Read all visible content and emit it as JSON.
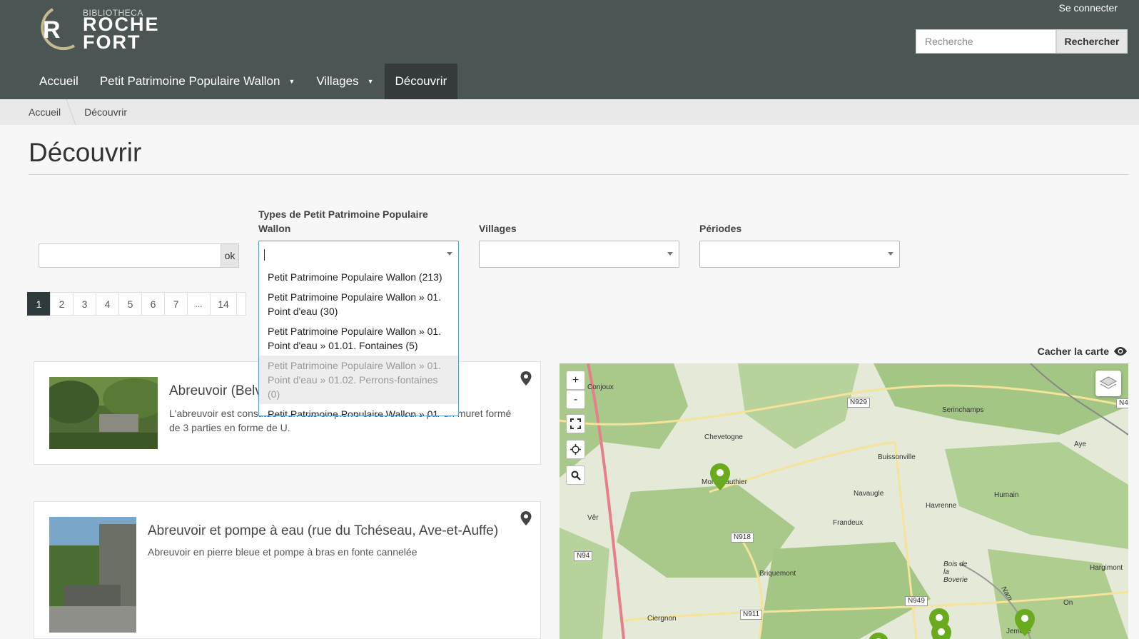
{
  "header": {
    "logo_small": "BIBLIOTHECA",
    "logo_line1": "ROCHE",
    "logo_line2": "FORT",
    "login": "Se connecter",
    "search_placeholder": "Recherche",
    "search_button": "Rechercher"
  },
  "nav": {
    "items": [
      {
        "label": "Accueil"
      },
      {
        "label": "Petit Patrimoine Populaire Wallon",
        "caret": "▼"
      },
      {
        "label": "Villages",
        "caret": "▼"
      },
      {
        "label": "Découvrir"
      }
    ]
  },
  "breadcrumb": [
    "Accueil",
    "Découvrir"
  ],
  "page": {
    "title": "Découvrir"
  },
  "filters": {
    "ok_label": "ok",
    "types_label": "Types de Petit Patrimoine Populaire Wallon",
    "villages_label": "Villages",
    "periodes_label": "Périodes"
  },
  "dropdown": {
    "options": [
      "Petit Patrimoine Populaire Wallon (213)",
      "Petit Patrimoine Populaire Wallon » 01. Point d'eau (30)",
      "Petit Patrimoine Populaire Wallon » 01. Point d'eau » 01.01. Fontaines (5)",
      "Petit Patrimoine Populaire Wallon » 01. Point d'eau » 01.02. Perrons-fontaines (0)",
      "Petit Patrimoine Populaire Wallon » 01."
    ]
  },
  "pagination": {
    "pages": [
      "1",
      "2",
      "3",
      "4",
      "5",
      "6",
      "7",
      "...",
      "14"
    ],
    "current": "1"
  },
  "results": [
    {
      "title": "Abreuvoir (Belvaux)",
      "description": "L'abreuvoir est constitué d'un bac en pierre et est entouré par un muret formé de 3 parties en forme de U."
    },
    {
      "title": "Abreuvoir et pompe à eau (rue du Tchéseau, Ave-et-Auffe)",
      "description": "Abreuvoir en pierre bleue et pompe à bras en fonte cannelée"
    }
  ],
  "map": {
    "toggle_label": "Cacher la carte",
    "zoom_in": "+",
    "zoom_out": "-",
    "places": [
      "Conjoux",
      "Chevetogne",
      "Mont-Gauthier",
      "Vêr",
      "Buissonville",
      "Serinchamps",
      "Aye",
      "Navaugle",
      "Havrenne",
      "Humain",
      "Frandeux",
      "Briquemont",
      "Ciergnon",
      "Hargimont",
      "On",
      "Jemelle",
      "Bois de la Boverie",
      "Nam"
    ],
    "roads": [
      "N929",
      "N918",
      "N94",
      "N949",
      "N911",
      "N4"
    ],
    "marker_color": "#6aaa1e"
  }
}
